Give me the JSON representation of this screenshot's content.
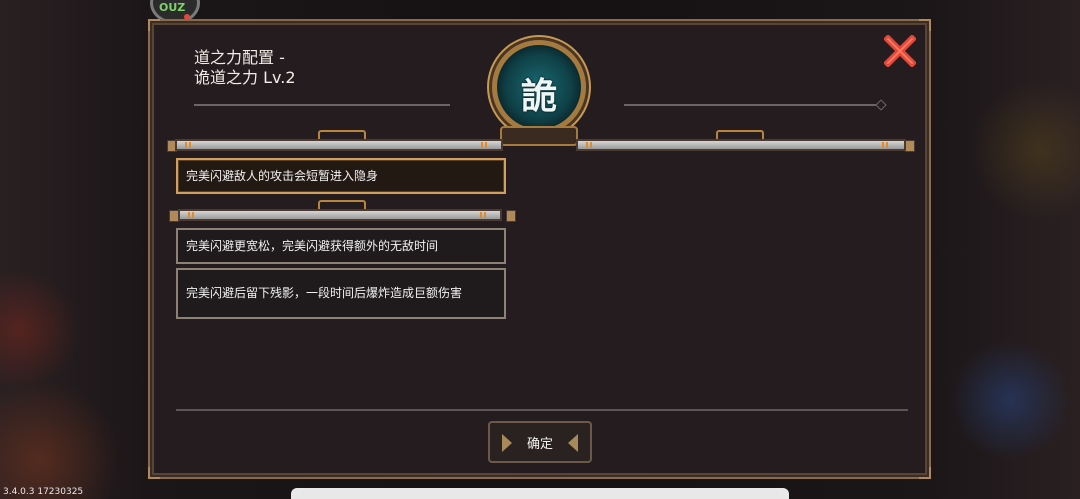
{
  "hud": {
    "counter_text": "OUZ"
  },
  "version_text": "3.4.0.3 17230325",
  "dialog": {
    "title_line1": "道之力配置 -",
    "title_line2": "诡道之力 Lv.2",
    "emblem_char": "詭",
    "options": [
      {
        "text": "完美闪避敌人的攻击会短暂进入隐身",
        "selected": true
      },
      {
        "text": "完美闪避更宽松，完美闪避获得额外的无敌时间",
        "selected": false
      },
      {
        "text": "完美闪避后留下残影，一段时间后爆炸造成巨额伤害",
        "selected": false
      }
    ],
    "confirm_label": "确定",
    "close_icon": "close-x-icon"
  },
  "colors": {
    "close_red": "#e2473b",
    "frame_gold": "#b08a5a",
    "emblem_teal": "#1b6a72"
  }
}
